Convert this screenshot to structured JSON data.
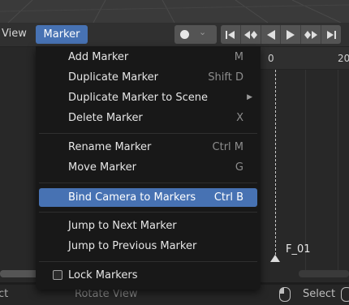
{
  "header": {
    "view_label": "View",
    "marker_label": "Marker"
  },
  "ruler": {
    "frame_start": "0",
    "frame_next": "20"
  },
  "marker": {
    "name": "F_01"
  },
  "menu": {
    "add_marker": {
      "label": "Add Marker",
      "shortcut": "M"
    },
    "duplicate_marker": {
      "label": "Duplicate Marker",
      "shortcut": "Shift D"
    },
    "duplicate_to_scene": {
      "label": "Duplicate Marker to Scene"
    },
    "delete_marker": {
      "label": "Delete Marker",
      "shortcut": "X"
    },
    "rename_marker": {
      "label": "Rename Marker",
      "shortcut": "Ctrl M"
    },
    "move_marker": {
      "label": "Move Marker",
      "shortcut": "G"
    },
    "bind_camera": {
      "label": "Bind Camera to Markers",
      "shortcut": "Ctrl B"
    },
    "jump_next": {
      "label": "Jump to Next Marker"
    },
    "jump_prev": {
      "label": "Jump to Previous Marker"
    },
    "lock_markers": {
      "label": "Lock Markers",
      "checked": false
    }
  },
  "status": {
    "left_fragment": "ct",
    "rotate_view": "Rotate View",
    "select": "Select"
  },
  "icons": {
    "record": "record-dot-icon",
    "transport": [
      "jump-to-start-icon",
      "jump-to-keyframe-prev-icon",
      "play-reverse-icon",
      "play-icon",
      "jump-to-keyframe-next-icon",
      "jump-to-end-icon"
    ]
  },
  "colors": {
    "accent": "#4772b3",
    "menu_bg": "#181818",
    "header_bg": "#303030"
  }
}
